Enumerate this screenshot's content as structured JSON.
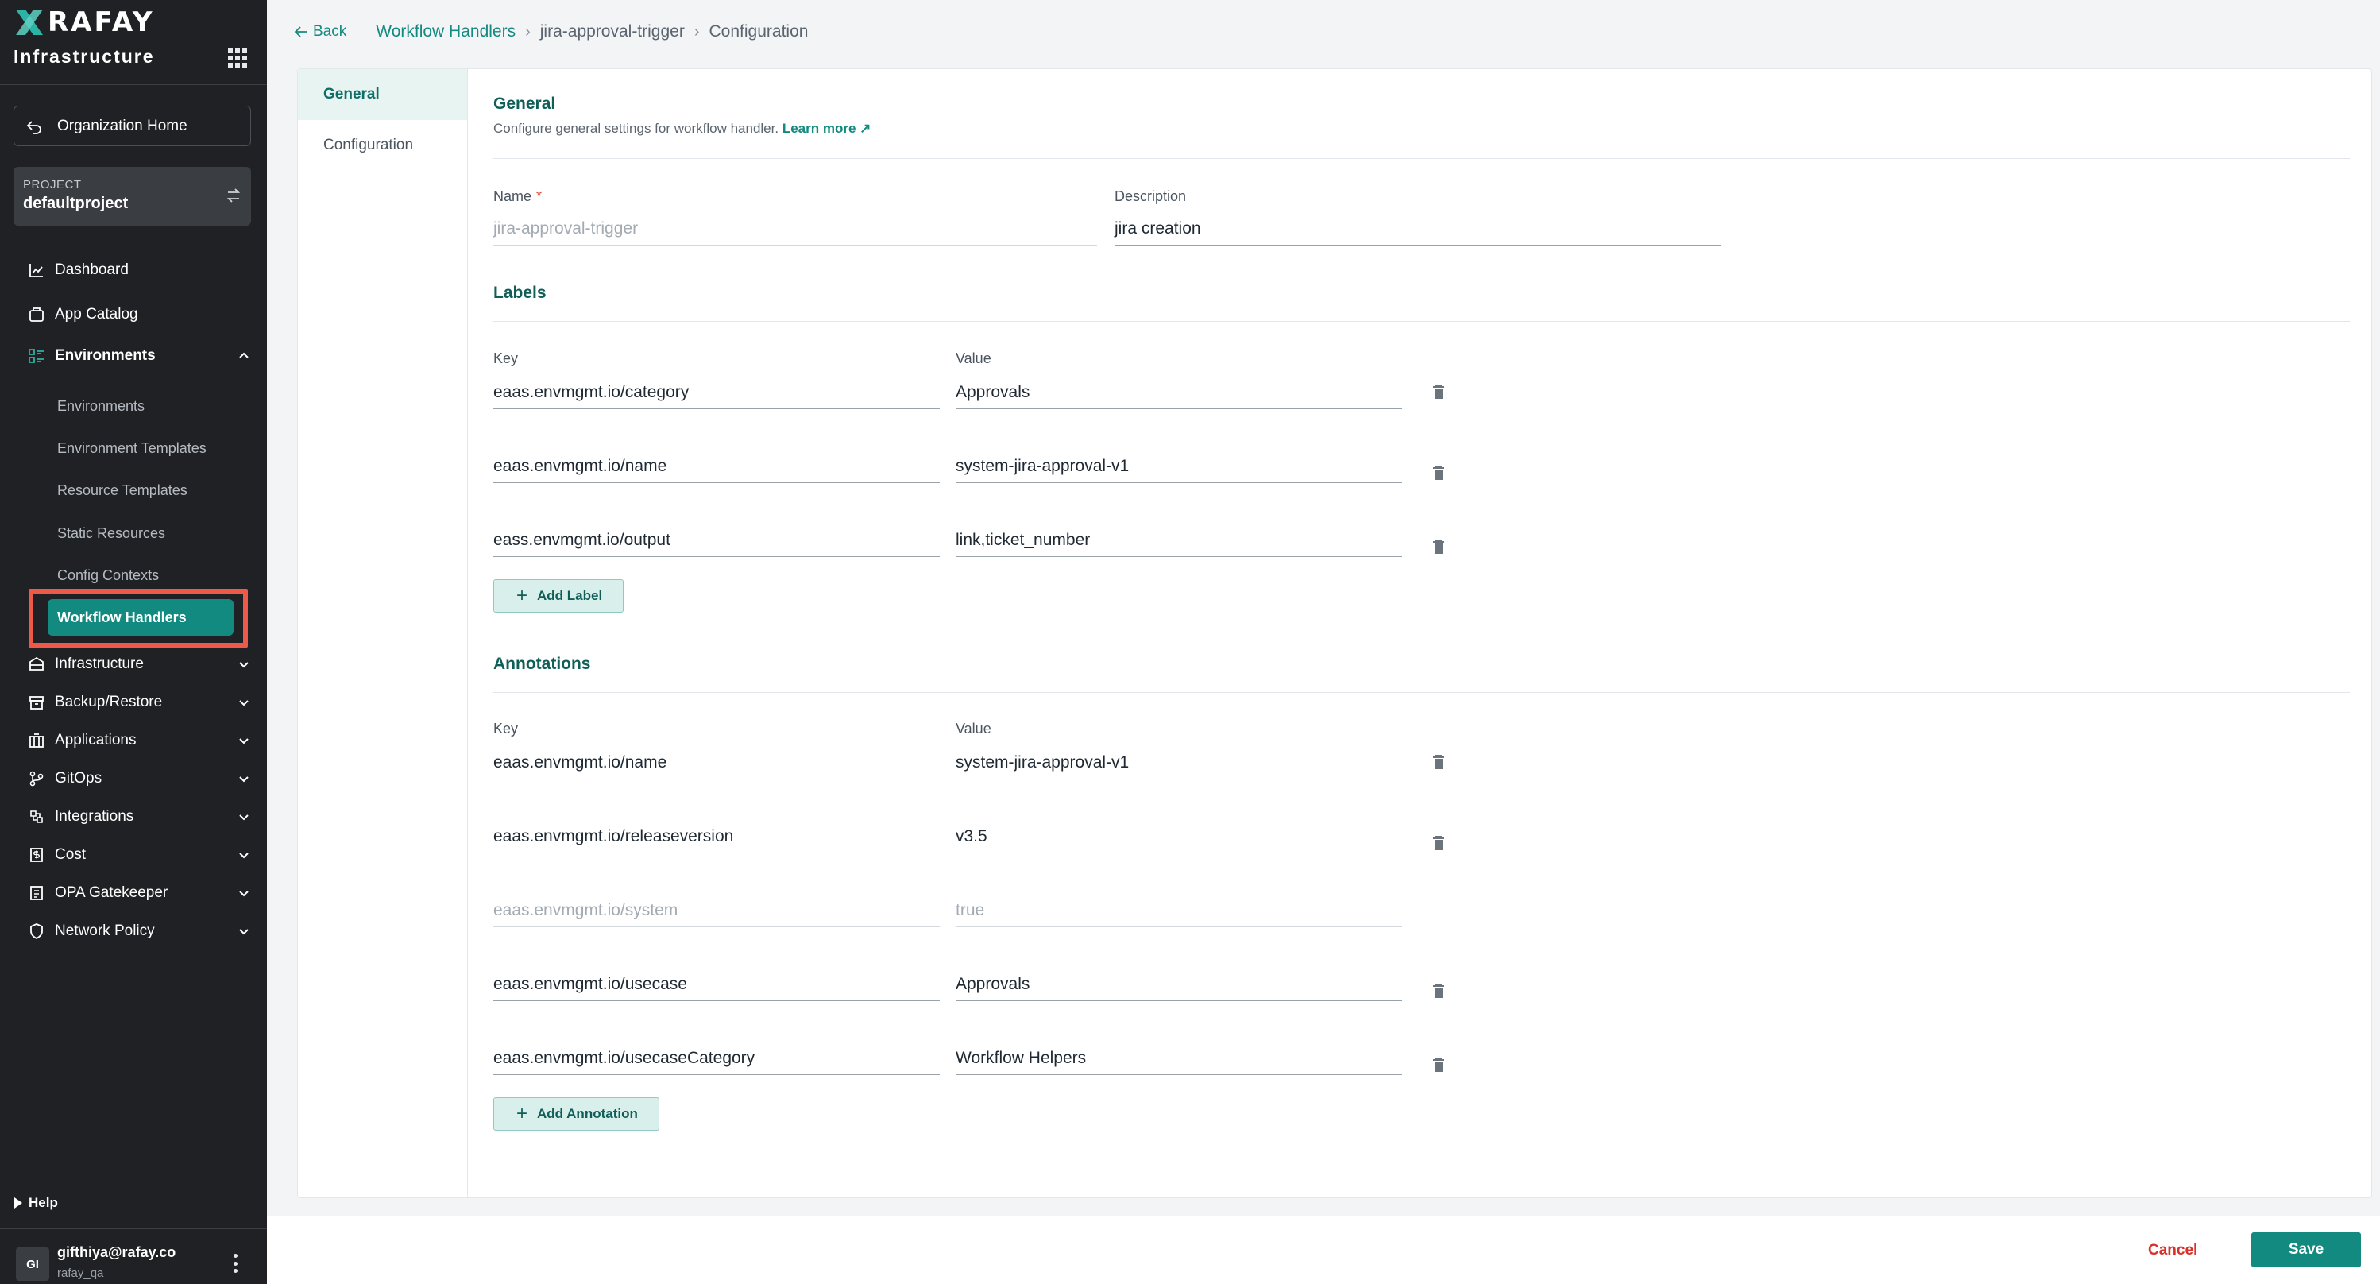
{
  "brand": {
    "logo_text": "RAFAY",
    "app_name": "Infrastructure"
  },
  "sidebar": {
    "org_home": "Organization Home",
    "project": {
      "label": "PROJECT",
      "name": "defaultproject"
    },
    "nav": [
      {
        "label": "Dashboard",
        "icon": "chart-icon"
      },
      {
        "label": "App Catalog",
        "icon": "catalog-icon"
      },
      {
        "label": "Environments",
        "icon": "environments-icon",
        "expanded": true
      },
      {
        "label": "Infrastructure",
        "icon": "infrastructure-icon"
      },
      {
        "label": "Backup/Restore",
        "icon": "backup-icon"
      },
      {
        "label": "Applications",
        "icon": "applications-icon"
      },
      {
        "label": "GitOps",
        "icon": "gitops-icon"
      },
      {
        "label": "Integrations",
        "icon": "integrations-icon"
      },
      {
        "label": "Cost",
        "icon": "cost-icon"
      },
      {
        "label": "OPA Gatekeeper",
        "icon": "opa-icon"
      },
      {
        "label": "Network Policy",
        "icon": "network-policy-icon"
      }
    ],
    "env_sub": [
      "Environments",
      "Environment Templates",
      "Resource Templates",
      "Static Resources",
      "Config Contexts",
      "Workflow Handlers"
    ],
    "help": "Help",
    "user": {
      "initials": "GI",
      "email": "gifthiya@rafay.co",
      "org": "rafay_qa"
    }
  },
  "breadcrumb": {
    "back": "Back",
    "items": [
      "Workflow Handlers",
      "jira-approval-trigger",
      "Configuration"
    ]
  },
  "tabs": [
    "General",
    "Configuration"
  ],
  "general": {
    "title": "General",
    "desc": "Configure general settings for workflow handler.",
    "learn_more": "Learn more",
    "name_label": "Name",
    "name_required": "*",
    "name_value": "jira-approval-trigger",
    "desc_label": "Description",
    "desc_value": "jira creation"
  },
  "labels": {
    "title": "Labels",
    "key_label": "Key",
    "value_label": "Value",
    "rows": [
      {
        "key": "eaas.envmgmt.io/category",
        "value": "Approvals"
      },
      {
        "key": "eaas.envmgmt.io/name",
        "value": "system-jira-approval-v1"
      },
      {
        "key": "eass.envmgmt.io/output",
        "value": "link,ticket_number"
      }
    ],
    "add": "Add Label"
  },
  "annotations": {
    "title": "Annotations",
    "key_label": "Key",
    "value_label": "Value",
    "rows": [
      {
        "key": "eaas.envmgmt.io/name",
        "value": "system-jira-approval-v1"
      },
      {
        "key": "eaas.envmgmt.io/releaseversion",
        "value": "v3.5"
      },
      {
        "key": "eaas.envmgmt.io/system",
        "value": "true"
      },
      {
        "key": "eaas.envmgmt.io/usecase",
        "value": "Approvals"
      },
      {
        "key": "eaas.envmgmt.io/usecaseCategory",
        "value": "Workflow Helpers"
      }
    ],
    "add": "Add Annotation"
  },
  "footer": {
    "cancel": "Cancel",
    "save": "Save"
  },
  "colors": {
    "accent": "#138a7f",
    "sidebar_bg": "#1f2124",
    "highlight": "#ee5a4a",
    "danger": "#d9302a"
  }
}
